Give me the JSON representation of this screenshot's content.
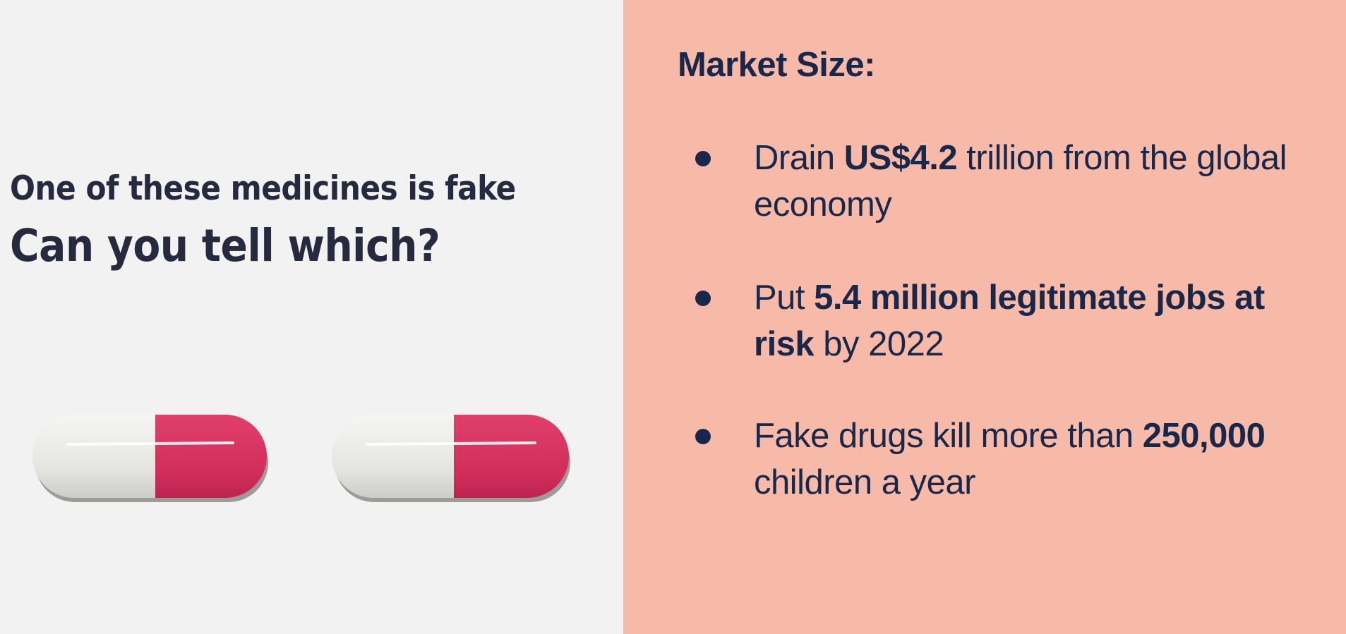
{
  "left": {
    "subtitle": "One of these medicines is fake",
    "title": "Can you tell which?"
  },
  "right": {
    "heading": "Market Size:",
    "bullets": [
      {
        "t1": "Drain ",
        "b1": "US$4.2",
        "t2": " trillion from the global economy",
        "b2": "",
        "t3": ""
      },
      {
        "t1": "Put ",
        "b1": "5.4 million legitimate jobs at risk",
        "t2": " by 2022",
        "b2": "",
        "t3": ""
      },
      {
        "t1": "Fake drugs kill more than ",
        "b1": "250,000",
        "t2": " children a year",
        "b2": "",
        "t3": ""
      }
    ]
  },
  "colors": {
    "left_background": "#f2f2f2",
    "right_background": "#f7baa8",
    "text_dark": "#262a3e",
    "text_navy": "#19284a",
    "capsule_white": "#e8e8e6",
    "capsule_red": "#d8305e"
  },
  "icons": [
    "capsule-icon",
    "capsule-icon",
    "bullet-dot",
    "bullet-dot",
    "bullet-dot"
  ]
}
